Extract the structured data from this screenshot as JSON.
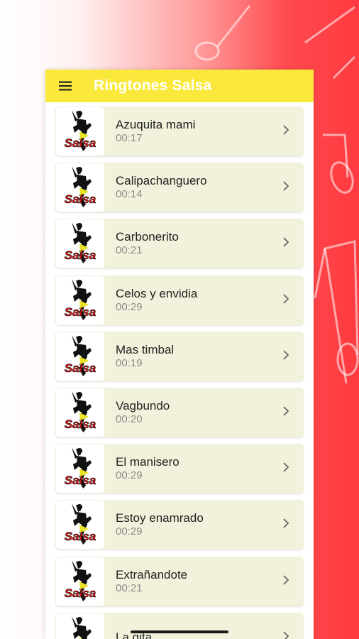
{
  "app": {
    "title": "Ringtones Salsa"
  },
  "icons": {
    "menu": "menu-icon",
    "chevron": "chevron-right-icon",
    "thumbnail": "salsa-dancer-thumbnail"
  },
  "colors": {
    "appbar": "#fbe83c",
    "item_bg": "#f2f2dc",
    "accent_red": "#ff3a40",
    "logo_red": "#e01818"
  },
  "thumbnail_text": "Salsa",
  "ringtones": [
    {
      "name": "Azuquita mami",
      "duration": "00:17"
    },
    {
      "name": "Calipachanguero",
      "duration": "00:14"
    },
    {
      "name": "Carbonerito",
      "duration": "00:21"
    },
    {
      "name": "Celos y envidia",
      "duration": "00:29"
    },
    {
      "name": "Mas timbal",
      "duration": "00:19"
    },
    {
      "name": "Vagbundo",
      "duration": "00:20"
    },
    {
      "name": "El manisero",
      "duration": "00:29"
    },
    {
      "name": "Estoy enamrado",
      "duration": "00:29"
    },
    {
      "name": "Extrañandote",
      "duration": "00:21"
    },
    {
      "name": "La gita",
      "duration": ""
    }
  ]
}
